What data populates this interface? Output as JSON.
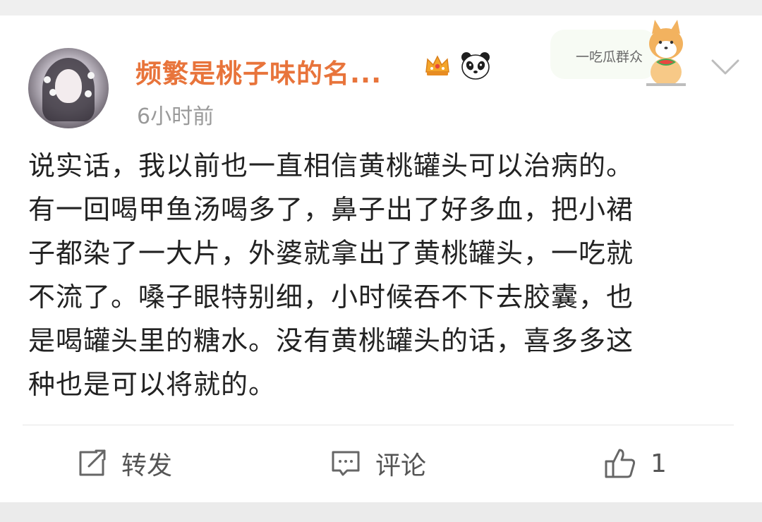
{
  "post": {
    "username": "频繁是桃子味的名...",
    "timestamp": "6小时前",
    "badge_icons": [
      "crown-icon",
      "panda-icon"
    ],
    "sticker_text": "一吃瓜群众",
    "body_lines": [
      "说实话，我以前也一直相信黄桃罐头可以治病的。",
      "有一回喝甲鱼汤喝多了，鼻子出了好多血，把小裙",
      "子都染了一大片，外婆就拿出了黄桃罐头，一吃就",
      "不流了。嗓子眼特别细，小时候吞不下去胶囊，也",
      "是喝罐头里的糖水。没有黄桃罐头的话，喜多多这",
      "种也是可以将就的。"
    ]
  },
  "actions": {
    "repost_label": "转发",
    "comment_label": "评论",
    "like_count": "1"
  },
  "colors": {
    "username": "#e8743b",
    "timestamp": "#9a9a9a",
    "body_text": "#222222",
    "action_text": "#555555",
    "background": "#efefef"
  }
}
